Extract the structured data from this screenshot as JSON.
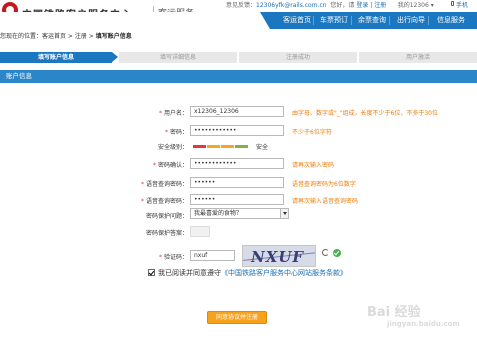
{
  "header": {
    "logo_text": "中国铁路客户服务中心",
    "logo_sub": "客运服务",
    "feedback_label": "意见反馈：",
    "feedback_email": "12306yfk@rails.com.cn",
    "greeting": "您好，请",
    "login": "登录",
    "separator": "|",
    "register": "注册",
    "my_account": "我的12306 ▾",
    "phone": "手机"
  },
  "nav": {
    "items": [
      "客运首页",
      "车票预订",
      "余票查询",
      "出行向导",
      "信息服务"
    ]
  },
  "breadcrumb": {
    "prefix": "您现在的位置：",
    "path": "客运首页 > 注册 > ",
    "current": "填写账户信息"
  },
  "steps": [
    "填写账户信息",
    "填写详细信息",
    "注册成功",
    "用户激活"
  ],
  "section_title": "账户信息",
  "form": {
    "username_label": "用户名：",
    "username_value": "x12306_12306",
    "username_hint": "由字母、数字或\"_\"组成，长度不少于6位，不多于30位",
    "password_label": "密码：",
    "password_value": "••••••••••••",
    "password_hint": "不少于6位字符",
    "strength_label": "安全级别：",
    "strength_value": "安全",
    "confirm_label": "密码确认：",
    "confirm_value": "••••••••••••",
    "confirm_hint": "请再次输入密码",
    "query_pw_label": "语音查询密码：",
    "query_pw_value": "••••••",
    "query_pw_hint": "语音查询密码为6位数字",
    "query_confirm_label": "语音查询密码：",
    "query_confirm_value": "••••••",
    "query_confirm_hint": "请再次输入语音查询密码",
    "question_label": "密码保护问题：",
    "question_value": "我最喜爱的食物？",
    "answer_label": "密码保护答案：",
    "answer_value": "",
    "captcha_label": "验证码：",
    "captcha_value": "nxuf",
    "captcha_image_text": "NXUF",
    "agree_text": "我已阅读并同意遵守",
    "terms_text": "《中国铁路客户服务中心网站服务条款》",
    "submit": "同意协议并注册"
  },
  "colors": {
    "nav_blue": "#1b78c0",
    "section_blue": "#2b86c9",
    "hint_orange": "#f07c08",
    "hint_red": "#e4393c",
    "submit_orange": "#f7a21c",
    "strength_red": "#e4393c",
    "strength_orange": "#f5a623",
    "strength_green": "#7cb342"
  },
  "watermark": {
    "text": "Bai 经验",
    "sub": "jingyan.baidu.com"
  }
}
